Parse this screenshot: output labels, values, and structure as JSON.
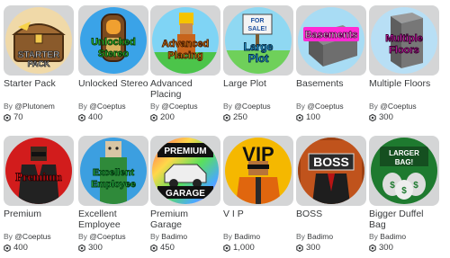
{
  "items": [
    {
      "name": "Starter Pack",
      "by": "By",
      "creator": "@Plutonem",
      "price": "70",
      "art_text": "STARTER PACK",
      "bg": "#e9c27a"
    },
    {
      "name": "Unlocked Stereo",
      "by": "By",
      "creator": "@Coeptus",
      "price": "400",
      "art_text": "Unlocked Stereo",
      "bg": "#3aa3e8"
    },
    {
      "name": "Advanced Placing",
      "by": "By",
      "creator": "@Coeptus",
      "price": "200",
      "art_text": "Advanced Placing",
      "bg": "#4cc44a"
    },
    {
      "name": "Large Plot",
      "by": "By",
      "creator": "@Coeptus",
      "price": "250",
      "art_text": "Large Plot",
      "bg": "#6fd05a"
    },
    {
      "name": "Basements",
      "by": "By",
      "creator": "@Coeptus",
      "price": "100",
      "art_text": "Basements",
      "bg": "#9ad3f0"
    },
    {
      "name": "Multiple Floors",
      "by": "By",
      "creator": "@Coeptus",
      "price": "300",
      "art_text": "Multiple Floors",
      "bg": "#b8dff5"
    },
    {
      "name": "Premium",
      "by": "By",
      "creator": "@Coeptus",
      "price": "400",
      "art_text": "Premium",
      "bg": "#d21c1c"
    },
    {
      "name": "Excellent Employee",
      "by": "By",
      "creator": "@Coeptus",
      "price": "300",
      "art_text": "Excellent Employee",
      "bg": "#3c9fe0"
    },
    {
      "name": "Premium Garage",
      "by": "By",
      "creator": "Badimo",
      "price": "450",
      "art_text_top": "PREMIUM",
      "art_text_bottom": "GARAGE",
      "bg": "#f2f2f2"
    },
    {
      "name": "V I P",
      "by": "By",
      "creator": "Badimo",
      "price": "1,000",
      "art_text": "VIP",
      "bg": "#f5b800"
    },
    {
      "name": "BOSS",
      "by": "By",
      "creator": "Badimo",
      "price": "300",
      "art_text": "BOSS",
      "bg": "#c0531c"
    },
    {
      "name": "Bigger Duffel Bag",
      "by": "By",
      "creator": "Badimo",
      "price": "300",
      "art_text": "LARGER BAG!",
      "bg": "#1e7a2f"
    }
  ],
  "colors": {
    "thumb_bg": "#d4d5d6",
    "text": "#393b3d",
    "muted": "#606264"
  },
  "icons": {
    "price": "robux-icon"
  }
}
